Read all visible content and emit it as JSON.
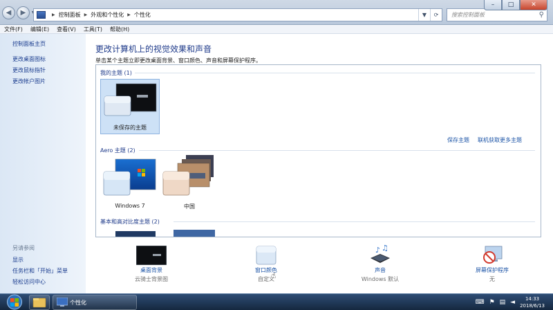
{
  "address": {
    "crumbs": [
      "控制面板",
      "外观和个性化",
      "个性化"
    ]
  },
  "search": {
    "placeholder": "搜索控制面板"
  },
  "window_buttons": {
    "min": "–",
    "max": "□",
    "close": "✕"
  },
  "menu": [
    "文件(F)",
    "编辑(E)",
    "查看(V)",
    "工具(T)",
    "帮助(H)"
  ],
  "sidebar": {
    "home": "控制面板主页",
    "links": [
      "更改桌面图标",
      "更改鼠标指针",
      "更改帐户图片"
    ],
    "see_also_title": "另请参阅",
    "see_also": [
      "显示",
      "任务栏和「开始」菜单",
      "轻松访问中心"
    ]
  },
  "main": {
    "title": "更改计算机上的视觉效果和声音",
    "subtitle": "单击某个主题立即更改桌面背景、窗口颜色、声音和屏幕保护程序。",
    "my_themes": {
      "title": "我的主题 (1)",
      "items": [
        {
          "name": "未保存的主题"
        }
      ]
    },
    "save_theme": "保存主题",
    "get_more": "联机获取更多主题",
    "aero_themes": {
      "title": "Aero 主题 (2)",
      "items": [
        {
          "name": "Windows 7"
        },
        {
          "name": "中国"
        }
      ]
    },
    "basic_themes": {
      "title": "基本和高对比度主题 (2)"
    }
  },
  "settings": [
    {
      "name": "桌面背景",
      "value": "云骑士背景图"
    },
    {
      "name": "窗口颜色",
      "value": "自定义"
    },
    {
      "name": "声音",
      "value": "Windows 默认"
    },
    {
      "name": "屏幕保护程序",
      "value": "无"
    }
  ],
  "taskbar": {
    "app_label": "个性化",
    "time": "14:33",
    "date": "2018/6/13"
  },
  "colors": {
    "accent_link": "#1b53a6",
    "title_blue": "#1e3a8a",
    "selection": "#cde1f6"
  }
}
